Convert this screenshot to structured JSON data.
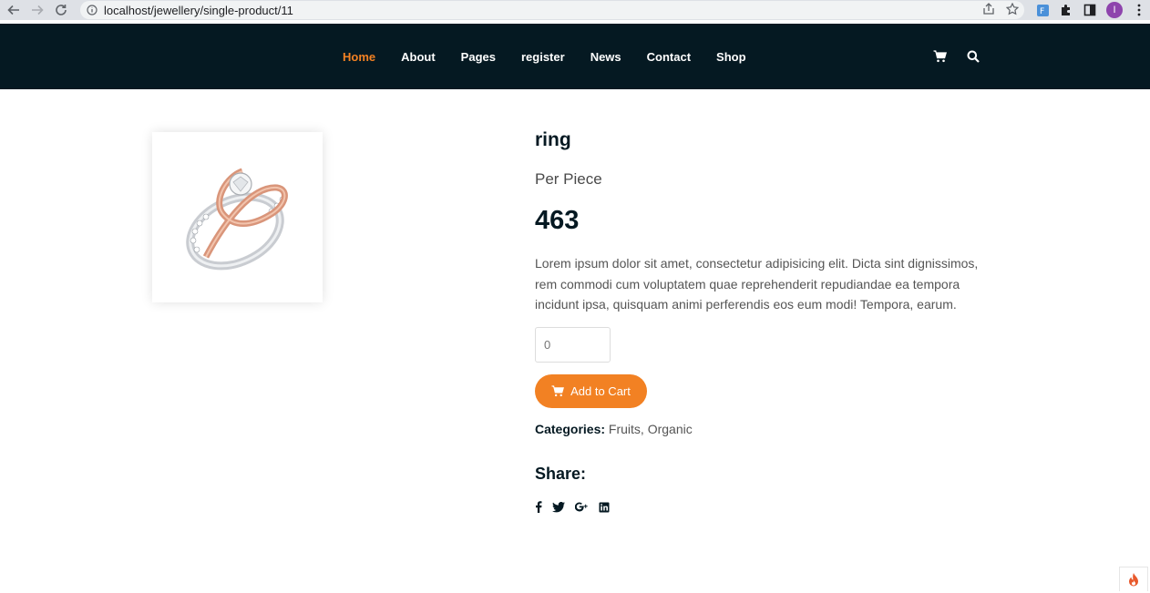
{
  "browser": {
    "url": "localhost/jewellery/single-product/11",
    "profile_initial": "I"
  },
  "nav": {
    "items": [
      {
        "label": "Home",
        "active": true
      },
      {
        "label": "About",
        "active": false
      },
      {
        "label": "Pages",
        "active": false
      },
      {
        "label": "register",
        "active": false
      },
      {
        "label": "News",
        "active": false
      },
      {
        "label": "Contact",
        "active": false
      },
      {
        "label": "Shop",
        "active": false
      }
    ]
  },
  "product": {
    "title": "ring",
    "unit": "Per Piece",
    "price": "463",
    "description": "Lorem ipsum dolor sit amet, consectetur adipisicing elit. Dicta sint dignissimos, rem commodi cum voluptatem quae reprehenderit repudiandae ea tempora incidunt ipsa, quisquam animi perferendis eos eum modi! Tempora, earum.",
    "quantity_placeholder": "0",
    "add_to_cart_label": "Add to Cart",
    "categories_label": "Categories:",
    "categories_value": "Fruits, Organic",
    "share_label": "Share:"
  },
  "colors": {
    "header_bg": "#051922",
    "accent": "#f28123",
    "text_dark": "#051922"
  }
}
